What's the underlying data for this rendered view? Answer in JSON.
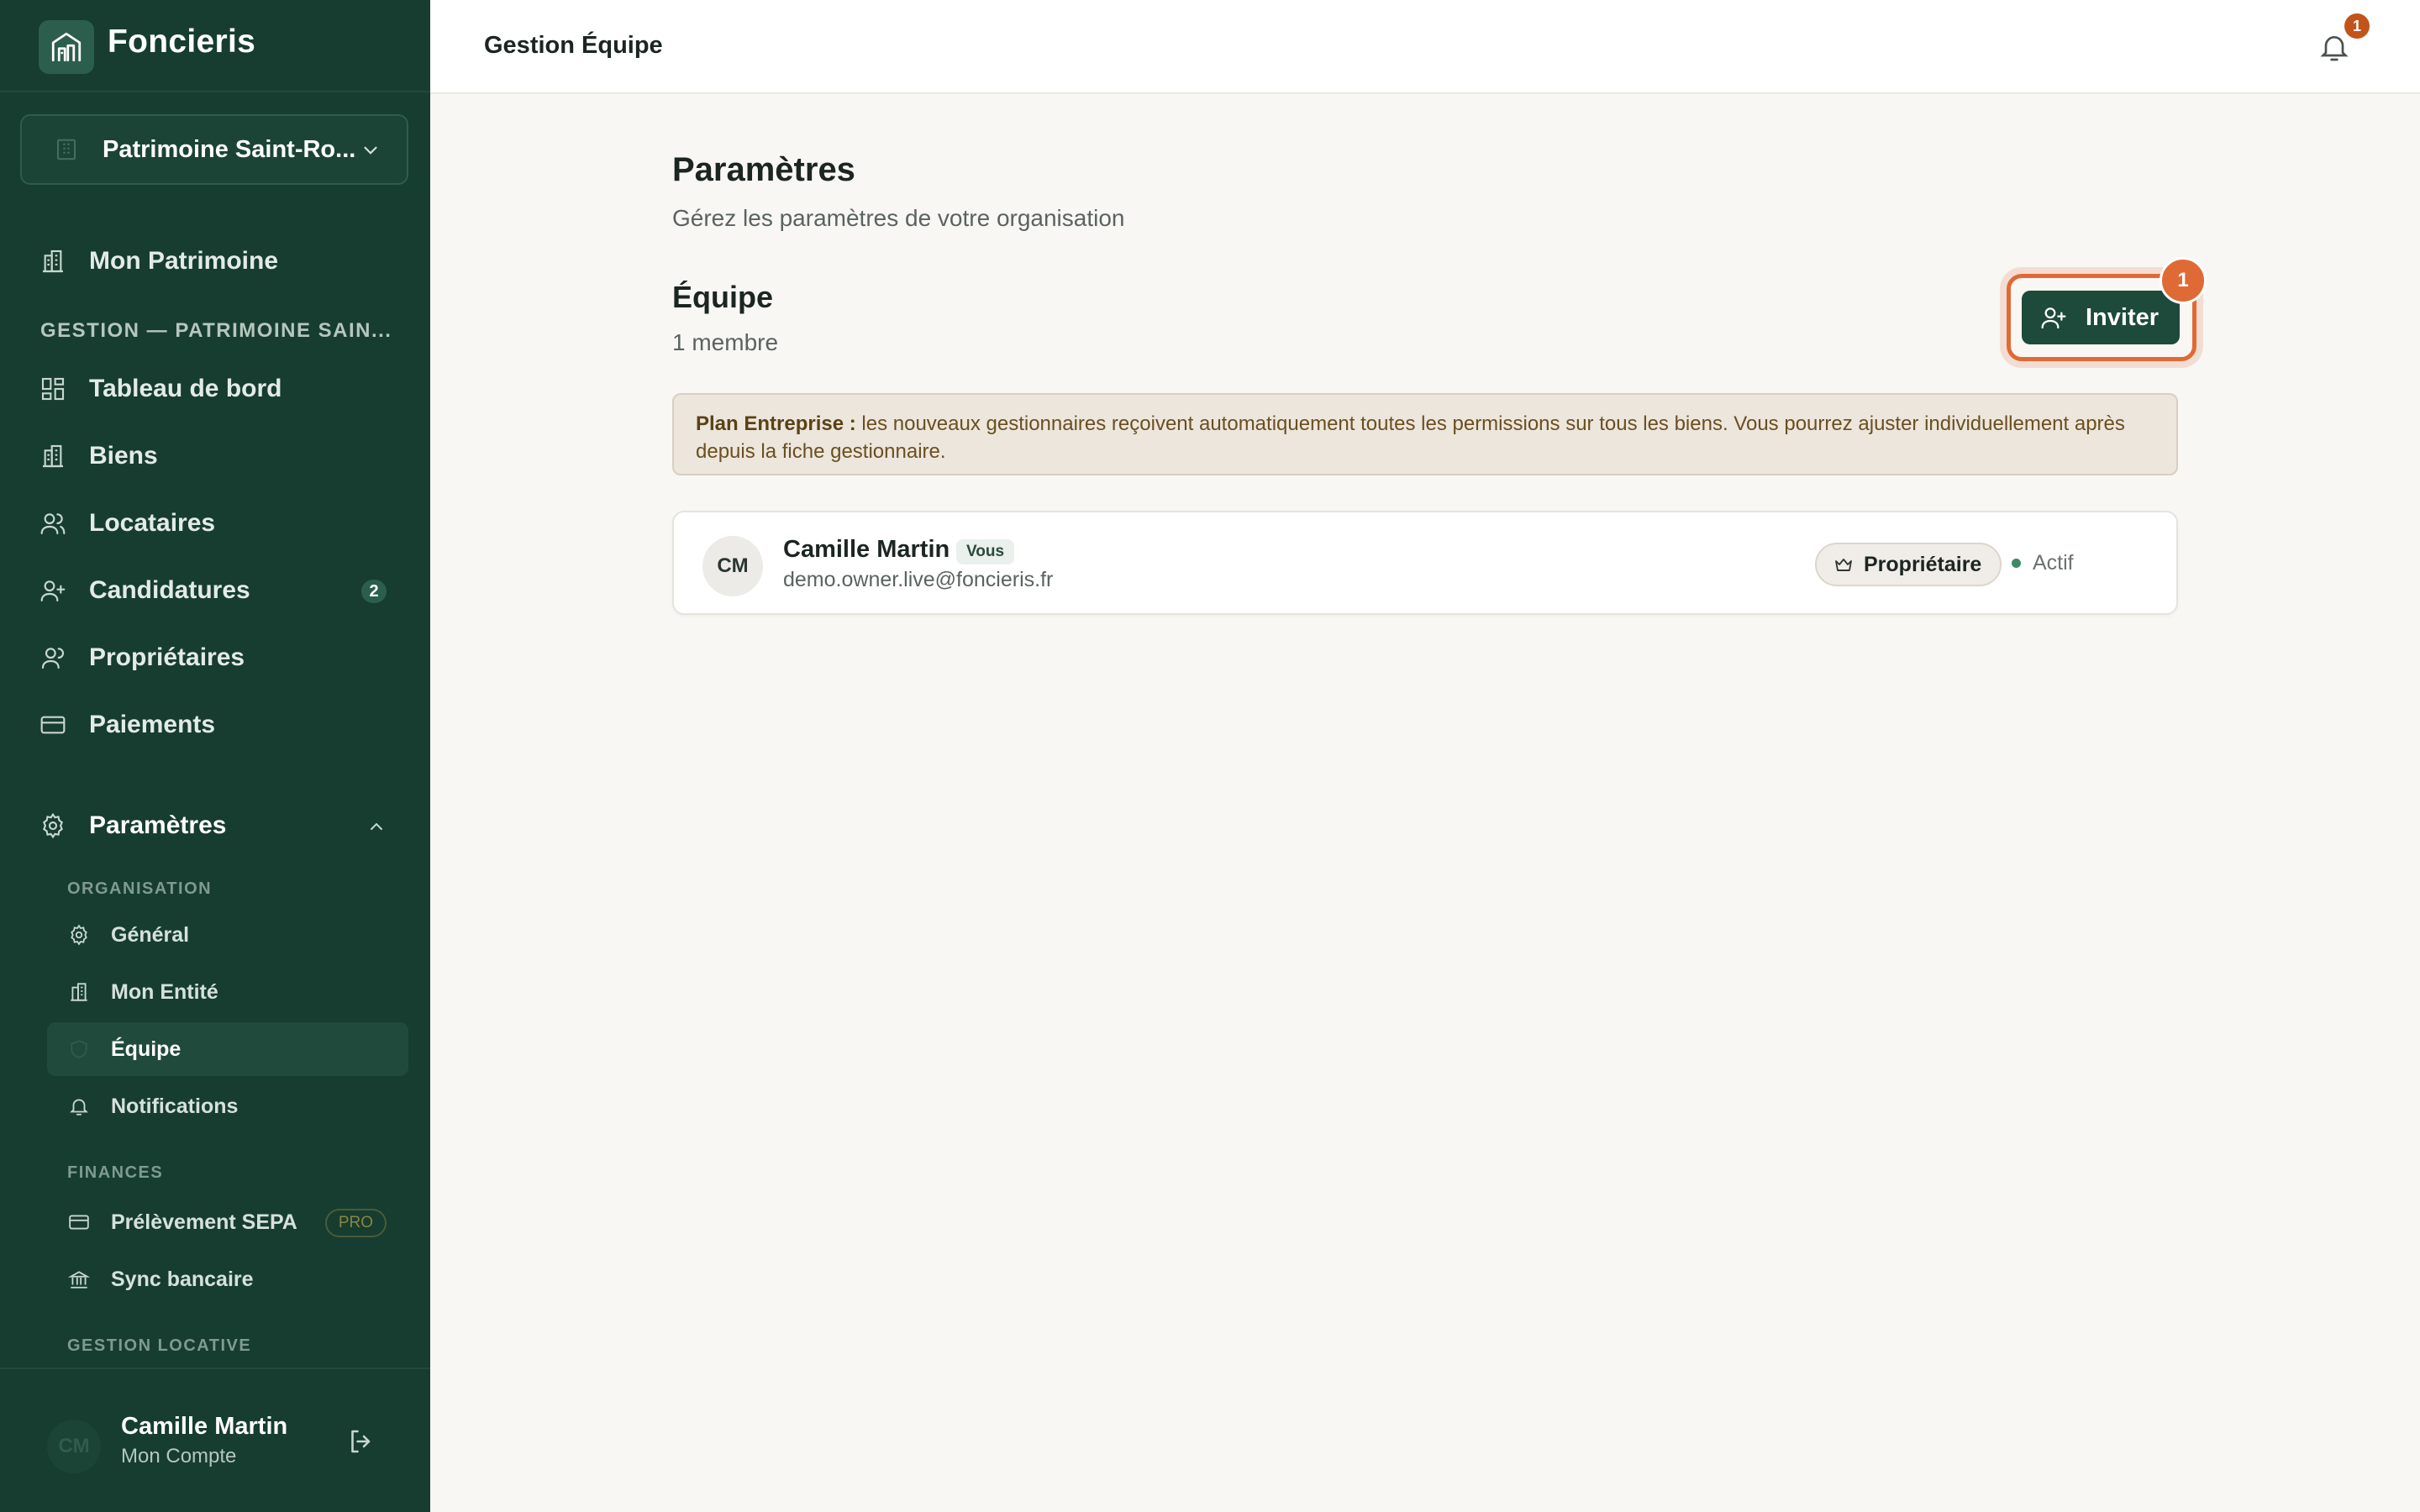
{
  "app": {
    "name": "Foncieris"
  },
  "sidebar": {
    "org_selector": {
      "value": "Patrimoine Saint-Ro..."
    },
    "mon_patrimoine": "Mon Patrimoine",
    "section_label": "GESTION — PATRIMOINE SAIN...",
    "items": [
      {
        "label": "Tableau de bord",
        "icon": "dashboard-icon"
      },
      {
        "label": "Biens",
        "icon": "building-icon"
      },
      {
        "label": "Locataires",
        "icon": "users-icon"
      },
      {
        "label": "Candidatures",
        "icon": "user-plus-icon",
        "count": "2"
      },
      {
        "label": "Propriétaires",
        "icon": "user-icon"
      },
      {
        "label": "Paiements",
        "icon": "card-icon"
      }
    ],
    "settings": {
      "label": "Paramètres",
      "groups": {
        "organisation": "ORGANISATION",
        "finances": "FINANCES",
        "gestion_locative": "GESTION LOCATIVE"
      },
      "items": {
        "general": "Général",
        "entite": "Mon Entité",
        "equipe": "Équipe",
        "notifications": "Notifications",
        "sepa": "Prélèvement SEPA",
        "sepa_badge": "PRO",
        "sync": "Sync bancaire"
      }
    },
    "footer": {
      "initials": "CM",
      "name": "Camille Martin",
      "sub": "Mon Compte"
    }
  },
  "topbar": {
    "title": "Gestion Équipe",
    "notification_count": "1"
  },
  "main": {
    "title": "Paramètres",
    "subtitle": "Gérez les paramètres de votre organisation",
    "team": {
      "title": "Équipe",
      "count_label": "1 membre"
    },
    "invite": {
      "label": "Inviter",
      "badge": "1"
    },
    "notice": {
      "strong": "Plan Entreprise :",
      "text": " les nouveaux gestionnaires reçoivent automatiquement toutes les permissions sur tous les biens. Vous pourrez ajuster individuellement après depuis la fiche gestionnaire."
    },
    "members": [
      {
        "initials": "CM",
        "name": "Camille Martin",
        "you_badge": "Vous",
        "email": "demo.owner.live@foncieris.fr",
        "role": "Propriétaire",
        "status": "Actif"
      }
    ]
  },
  "colors": {
    "sidebar_bg": "#163d30",
    "accent": "#1d4a3b",
    "highlight": "#e06a35",
    "status_active": "#3c8b64"
  }
}
